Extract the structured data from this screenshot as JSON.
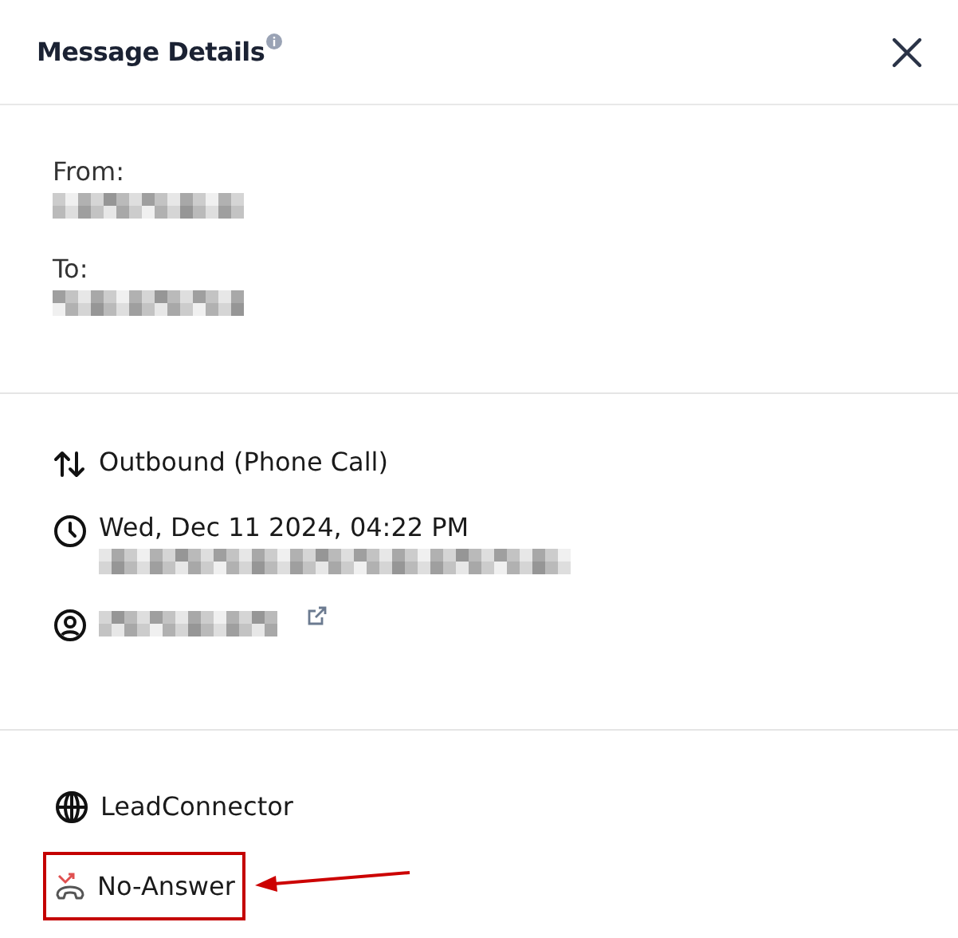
{
  "panel": {
    "title": "Message Details",
    "has_info": true
  },
  "addresses": [
    {
      "label": "From:",
      "redacted": true
    },
    {
      "label": "To:",
      "redacted": true
    }
  ],
  "details": [
    {
      "kind": "direction",
      "text": "Outbound (Phone Call)"
    },
    {
      "kind": "time",
      "text": "Wed, Dec 11 2024, 04:22 PM",
      "sub_redacted": true
    },
    {
      "kind": "contact",
      "redacted": true,
      "external_link": true
    }
  ],
  "meta": [
    {
      "kind": "channel",
      "text": "LeadConnector",
      "highlighted": false
    },
    {
      "kind": "status",
      "text": "No-Answer",
      "highlighted": true
    }
  ]
}
